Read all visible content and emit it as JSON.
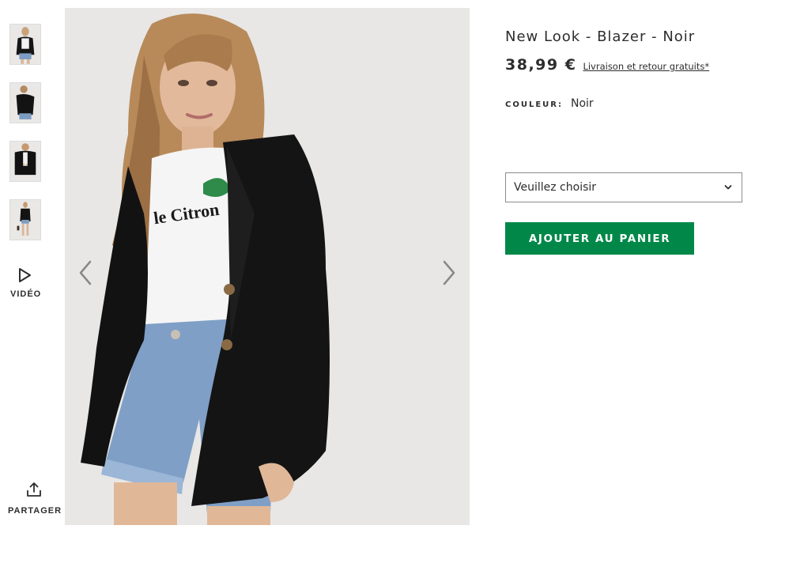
{
  "gallery": {
    "thumbnails": [
      {
        "label": "thumbnail-1"
      },
      {
        "label": "thumbnail-2"
      },
      {
        "label": "thumbnail-3"
      },
      {
        "label": "thumbnail-4"
      }
    ],
    "video_label": "VIDÉO",
    "share_label": "PARTAGER",
    "main_image_texts": [
      "le Citron"
    ]
  },
  "product": {
    "title": "New Look - Blazer - Noir",
    "price": "38,99 €",
    "delivery_link": "Livraison et retour gratuits*",
    "color_label": "COULEUR:",
    "color_value": "Noir",
    "size_select": {
      "selected": "Veuillez choisir"
    },
    "add_to_cart": "AJOUTER AU PANIER"
  },
  "icons": {
    "play": "play-icon",
    "share": "share-icon",
    "arrow_left": "chevron-left-icon",
    "arrow_right": "chevron-right-icon",
    "dropdown": "chevron-down-icon"
  },
  "colors": {
    "accent_green": "#018849",
    "text": "#2d2d2d",
    "image_bg": "#e7e6e5"
  }
}
